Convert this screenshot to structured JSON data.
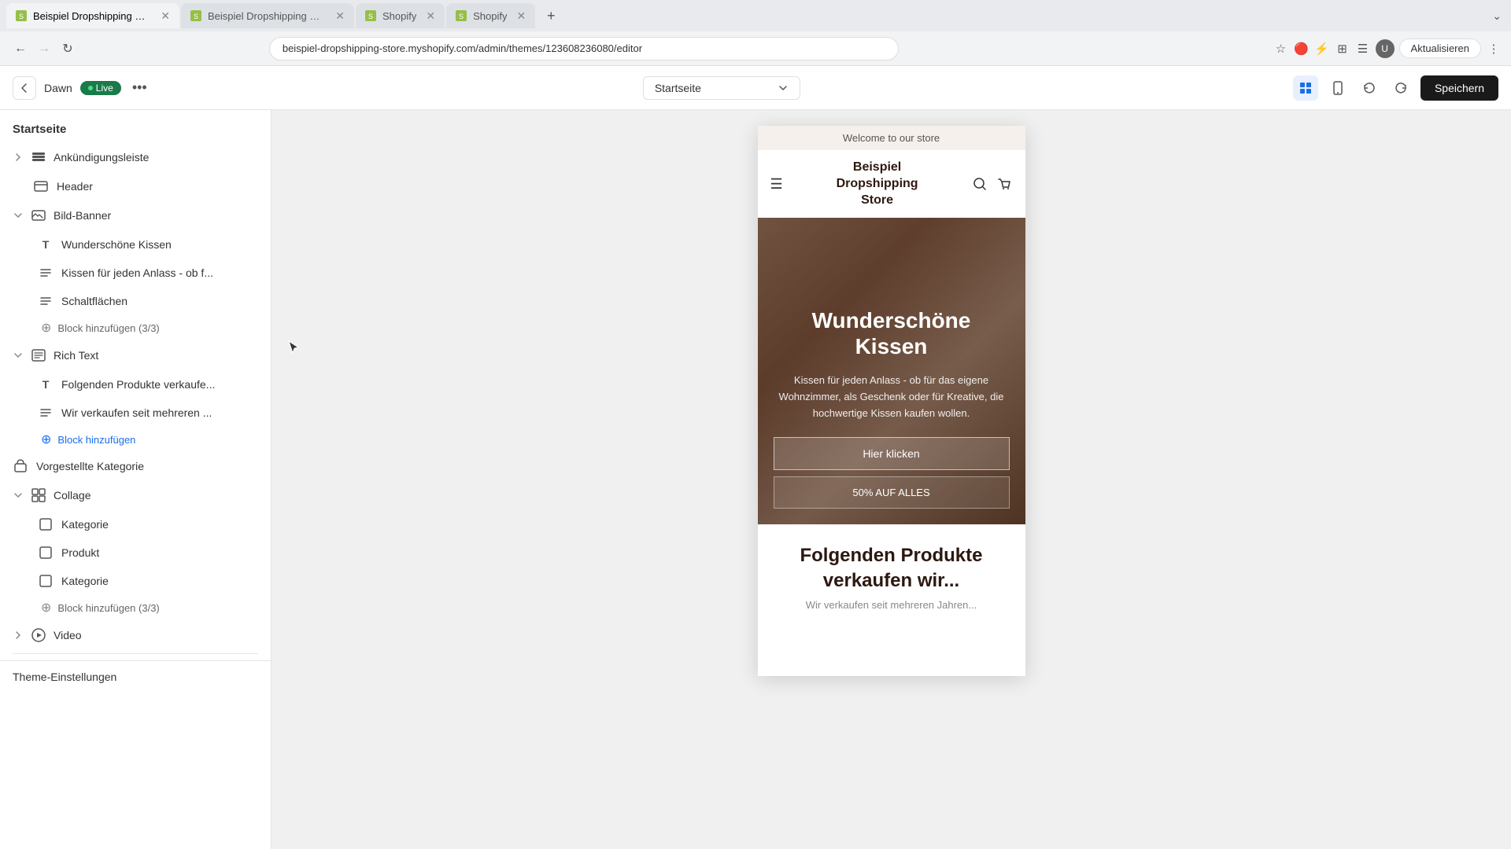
{
  "browser": {
    "tabs": [
      {
        "id": "t1",
        "label": "Beispiel Dropshipping Store - ...",
        "active": true,
        "icon_color": "#96bf48"
      },
      {
        "id": "t2",
        "label": "Beispiel Dropshipping Store",
        "active": false,
        "icon_color": "#96bf48"
      },
      {
        "id": "t3",
        "label": "Shopify",
        "active": false,
        "icon_color": "#96bf48"
      },
      {
        "id": "t4",
        "label": "Shopify",
        "active": false,
        "icon_color": "#96bf48"
      }
    ],
    "url": "beispiel-dropshipping-store.myshopify.com/admin/themes/123608236080/editor",
    "update_label": "Aktualisieren"
  },
  "topbar": {
    "theme_name": "Dawn",
    "live_label": "Live",
    "more_label": "...",
    "page_selector_value": "Startseite",
    "save_label": "Speichern"
  },
  "sidebar": {
    "title": "Startseite",
    "sections": [
      {
        "id": "ankuendigungsleiste",
        "label": "Ankündigungsleiste",
        "icon": "grid",
        "expandable": true,
        "expanded": false,
        "indent": 0
      },
      {
        "id": "header",
        "label": "Header",
        "icon": "grid-small",
        "expandable": false,
        "indent": 0
      },
      {
        "id": "bild-banner",
        "label": "Bild-Banner",
        "icon": "image",
        "expandable": true,
        "expanded": true,
        "indent": 0,
        "children": [
          {
            "id": "wunderschoene-kissen",
            "label": "Wunderschöne Kissen",
            "icon": "T"
          },
          {
            "id": "kissen-fuer-jeden",
            "label": "Kissen für jeden Anlass - ob f...",
            "icon": "list"
          },
          {
            "id": "schaltflaechen",
            "label": "Schaltflächen",
            "icon": "list"
          },
          {
            "id": "add-block-bild",
            "label": "Block hinzufügen (3/3)",
            "type": "add"
          }
        ]
      },
      {
        "id": "rich-text",
        "label": "Rich Text",
        "icon": "doc",
        "expandable": true,
        "expanded": true,
        "indent": 0,
        "children": [
          {
            "id": "folgenden-produkte",
            "label": "Folgenden Produkte verkaufe...",
            "icon": "T"
          },
          {
            "id": "wir-verkaufen",
            "label": "Wir verkaufen seit mehreren ...",
            "icon": "list"
          },
          {
            "id": "add-block-rich",
            "label": "Block hinzufügen",
            "type": "add-blue"
          }
        ]
      },
      {
        "id": "vorgestellte-kategorie",
        "label": "Vorgestellte Kategorie",
        "icon": "lock",
        "expandable": false,
        "indent": 0
      },
      {
        "id": "collage",
        "label": "Collage",
        "icon": "grid4",
        "expandable": true,
        "expanded": true,
        "indent": 0,
        "children": [
          {
            "id": "kategorie-1",
            "label": "Kategorie",
            "icon": "frame"
          },
          {
            "id": "produkt",
            "label": "Produkt",
            "icon": "frame"
          },
          {
            "id": "kategorie-2",
            "label": "Kategorie",
            "icon": "frame"
          },
          {
            "id": "add-block-collage",
            "label": "Block hinzufügen (3/3)",
            "type": "add"
          }
        ]
      },
      {
        "id": "video",
        "label": "Video",
        "icon": "play",
        "expandable": true,
        "expanded": false,
        "indent": 0
      }
    ],
    "theme_settings": "Theme-Einstellungen"
  },
  "preview": {
    "welcome": "Welcome to our store",
    "store_title": "Beispiel\nDropshipping\nStore",
    "banner_title": "Wunderschöne\nKissen",
    "banner_desc": "Kissen für jeden Anlass - ob für das eigene Wohnzimmer, als Geschenk oder für Kreative, die hochwertige Kissen kaufen wollen.",
    "btn_primary": "Hier klicken",
    "btn_secondary": "50% AUF ALLES",
    "rich_title": "Folgenden Produkte verkaufen wir...",
    "rich_subtitle": "Wir verkaufen seit mehreren Jahren..."
  }
}
